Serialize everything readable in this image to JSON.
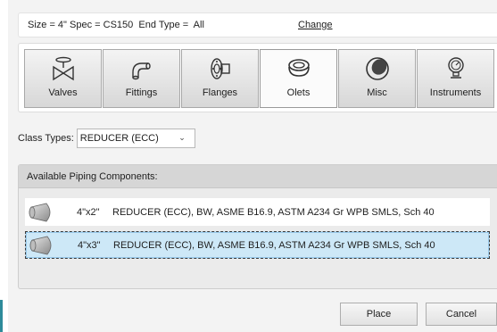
{
  "header": {
    "size_text": "Size = 4\"",
    "spec_text": "Spec = CS150",
    "end_type_text": "End Type =  All",
    "change_label": "Change"
  },
  "categories": [
    {
      "label": "Valves",
      "icon": "valve-icon",
      "active": false
    },
    {
      "label": "Fittings",
      "icon": "elbow-fitting-icon",
      "active": false
    },
    {
      "label": "Flanges",
      "icon": "flange-icon",
      "active": false
    },
    {
      "label": "Olets",
      "icon": "olet-icon",
      "active": true
    },
    {
      "label": "Misc",
      "icon": "misc-cap-icon",
      "active": false
    },
    {
      "label": "Instruments",
      "icon": "gauge-icon",
      "active": false
    }
  ],
  "class_types": {
    "label": "Class Types:",
    "selected": "REDUCER (ECC)"
  },
  "components": {
    "header": "Available Piping Components:",
    "rows": [
      {
        "size": "4\"x2\"",
        "description": "REDUCER (ECC), BW, ASME B16.9, ASTM A234 Gr WPB SMLS, Sch 40",
        "selected": false,
        "icon": "reducer-icon"
      },
      {
        "size": "4\"x3\"",
        "description": "REDUCER (ECC), BW, ASME B16.9, ASTM A234 Gr WPB SMLS, Sch 40",
        "selected": true,
        "icon": "reducer-icon"
      }
    ]
  },
  "buttons": {
    "place": "Place",
    "cancel": "Cancel"
  },
  "colors": {
    "selection": "#cde8f7",
    "accent": "#2e8b9a"
  }
}
